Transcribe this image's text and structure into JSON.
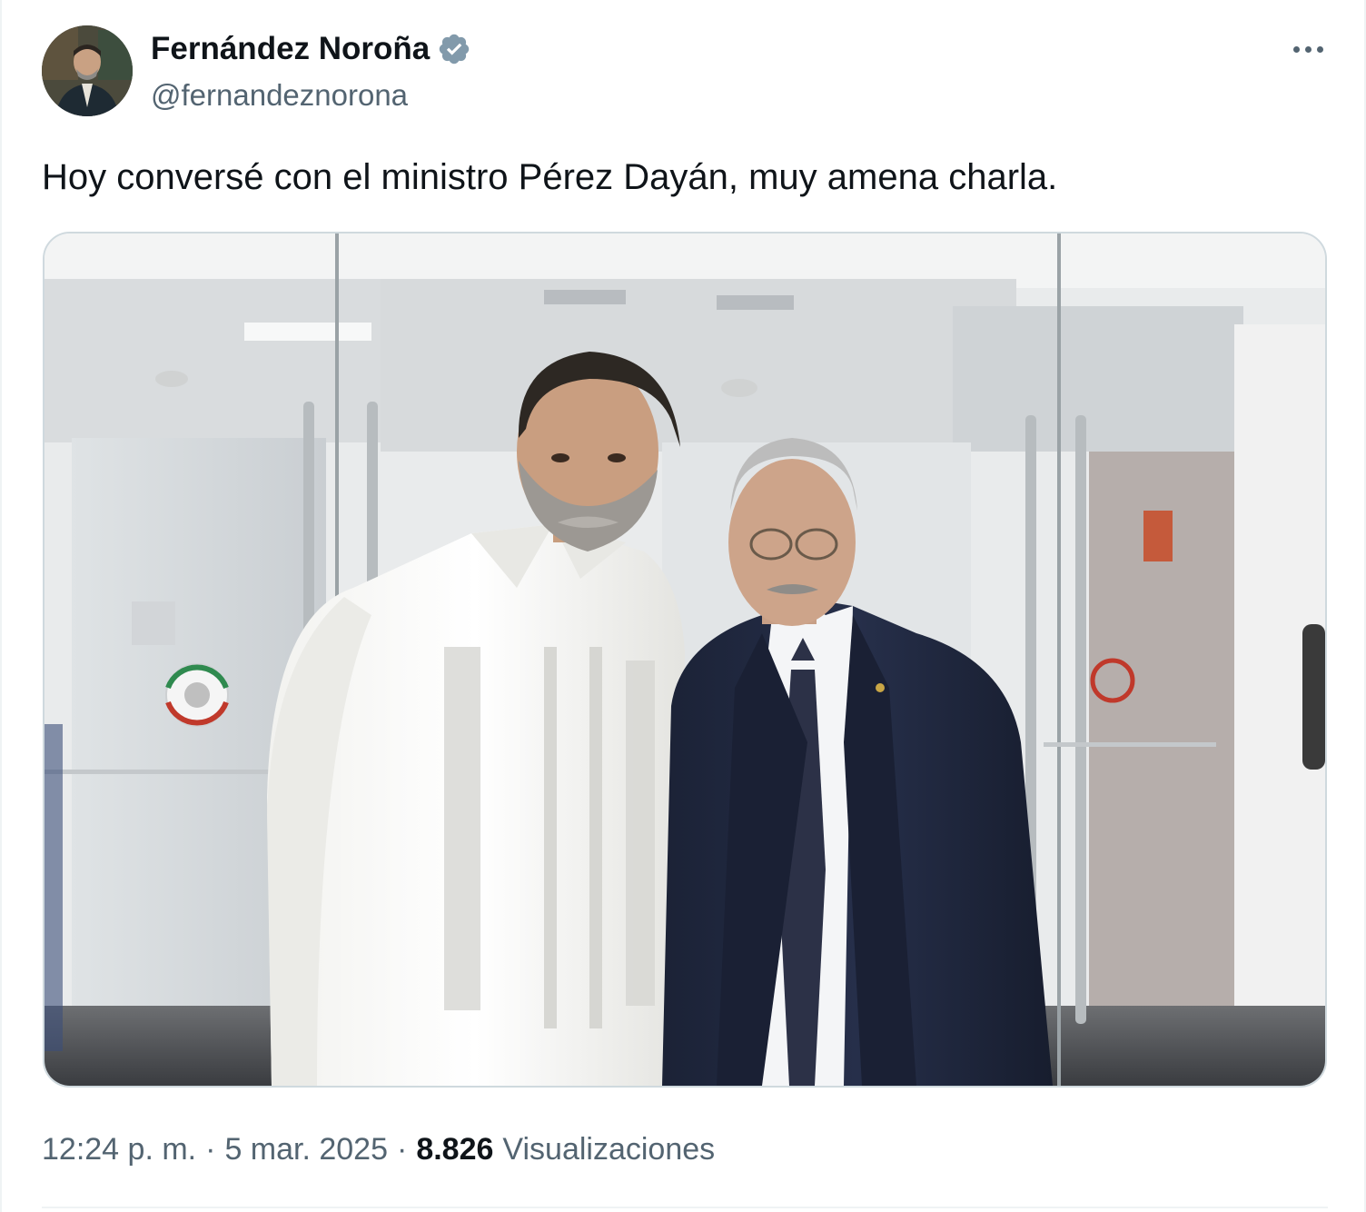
{
  "author": {
    "display_name": "Fernández Noroña",
    "handle": "@fernandeznorona",
    "verified_icon": "verified-badge-icon",
    "avatar_icon": "avatar-photo"
  },
  "more_icon": "more-options-icon",
  "tweet": {
    "text": "Hoy conversé con el ministro Pérez Dayán, muy amena charla."
  },
  "media": {
    "type": "photo"
  },
  "meta": {
    "time": "12:24 p. m.",
    "separator": "·",
    "date": "5 mar. 2025",
    "views_count": "8.826",
    "views_label": "Visualizaciones"
  },
  "colors": {
    "text_primary": "#0f1419",
    "text_secondary": "#536471",
    "verified_blue": "#1d9bf0",
    "border": "#cfd9de"
  }
}
